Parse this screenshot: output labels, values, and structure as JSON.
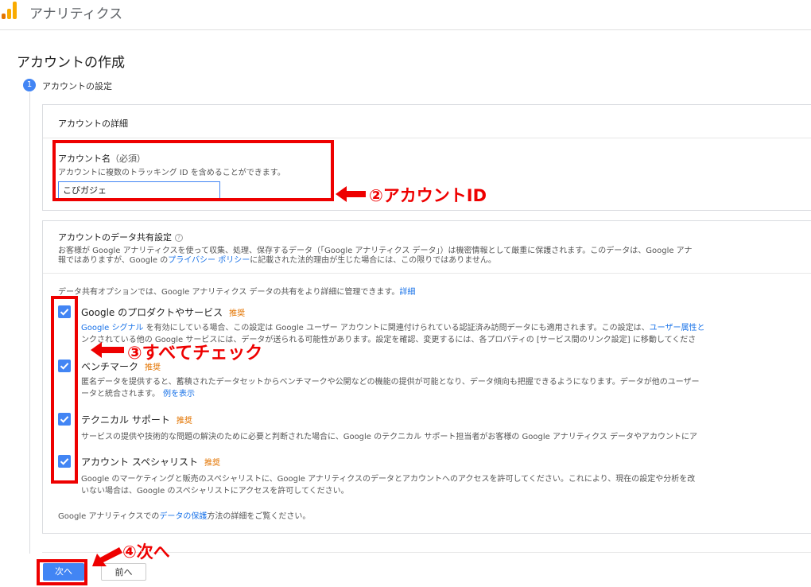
{
  "app": {
    "title": "アナリティクス"
  },
  "page": {
    "title": "アカウントの作成"
  },
  "step": {
    "number": "1",
    "label": "アカウントの設定"
  },
  "details": {
    "header": "アカウントの詳細",
    "name_label": "アカウント名",
    "name_required": "（必須）",
    "name_hint": "アカウントに複数のトラッキング ID を含めることができます。",
    "name_value": "こびガジェ"
  },
  "sharing": {
    "title": "アカウントのデータ共有設定",
    "help_icon": "?",
    "desc_line1": "お客様が Google アナリティクスを使って収集、処理、保存するデータ（「Google アナリティクス データ」）は機密情報として厳重に保護されます。このデータは、Google アナ",
    "desc_line2_pre": "報ではありますが、Google の",
    "desc_line2_link": "プライバシー ポリシー",
    "desc_line2_post": "に記載された法的理由が生じた場合には、この限りではありません。",
    "intro_pre": "データ共有オプションでは、Google アナリティクス データの共有をより詳細に管理できます。",
    "intro_link": "詳細",
    "recommended": "推奨",
    "options": [
      {
        "title": "Google のプロダクトやサービス",
        "line1_link": "Google シグナル",
        "line1_mid": " を有効にしている場合、この設定は Google ユーザー アカウントに関連付けられている認証済み訪問データにも適用されます。この設定は、",
        "line1_link2": "ユーザー属性と",
        "line2": "ンクされている他の Google サービスには、データが送られる可能性があります。設定を確認、変更するには、各プロパティの [サービス間のリンク設定] に移動してくださ"
      },
      {
        "title": "ベンチマーク",
        "line1": "匿名データを提供すると、蓄積されたデータセットからベンチマークや公開などの機能の提供が可能となり、データ傾向も把握できるようになります。データが他のユーザー",
        "line2_pre": "ータと統合されます。",
        "line2_link": "例を表示"
      },
      {
        "title": "テクニカル サポート",
        "line1": "サービスの提供や技術的な問題の解決のために必要と判断された場合に、Google のテクニカル サポート担当者がお客様の Google アナリティクス データやアカウントにア"
      },
      {
        "title": "アカウント スペシャリスト",
        "line1": "Google のマーケティングと販売のスペシャリストに、Google アナリティクスのデータとアカウントへのアクセスを許可してください。これにより、現在の設定や分析を改",
        "line2": "いない場合は、Google のスペシャリストにアクセスを許可してください。"
      }
    ],
    "footer_pre": "Google アナリティクスでの",
    "footer_link": "データの保護",
    "footer_post": "方法の詳細をご覧ください。"
  },
  "buttons": {
    "next": "次へ",
    "prev": "前へ"
  },
  "annotations": {
    "account_id": "②アカウントID",
    "check_all": "③すべてチェック",
    "next": "④次へ"
  },
  "colors": {
    "accent": "#4285f4",
    "annotation": "#ee0000",
    "recommended": "#e37400",
    "link": "#1a73e8"
  },
  "icons": {
    "logo": "analytics-logo-icon",
    "checkbox": "checkbox-checked-icon",
    "arrow": "red-arrow-icon"
  }
}
